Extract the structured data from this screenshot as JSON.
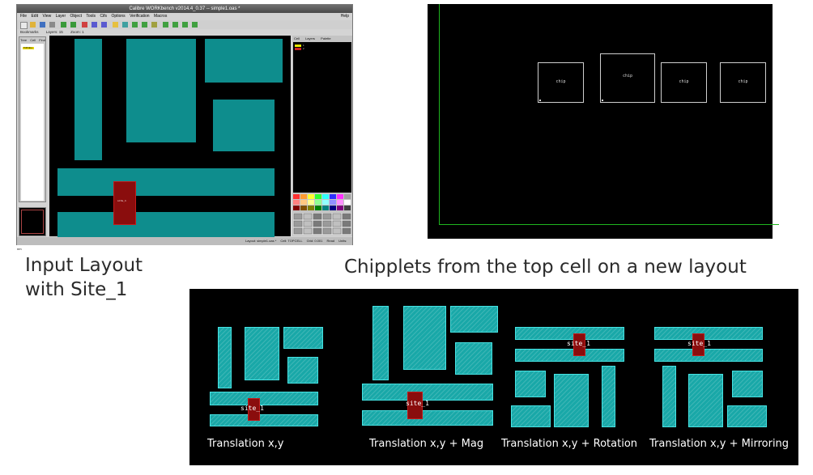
{
  "editor": {
    "window_title": "Calibre WORKbench v2014.4_0.37  --  simple1.oas *",
    "menu": [
      "File",
      "Edit",
      "View",
      "Layer",
      "Object",
      "Tools",
      "Cifs",
      "Options",
      "Verification",
      "Macros"
    ],
    "menu_help": "Help",
    "toolbar2": [
      "Bookmarks",
      "Layers: 15",
      "Zoom: 1"
    ],
    "panel_tabs": [
      "Tree",
      "Cell",
      "Find"
    ],
    "tree_root": "TOPCELL",
    "right_panel_tabs": [
      "Cell",
      "Layers",
      "Palette"
    ],
    "layer_names": [
      "1",
      "2"
    ],
    "site_label": "site_1",
    "status": [
      "Layout: simple1.oas *",
      "Cell: TOPCELL",
      "Grid: 0.001",
      "Read",
      "Units: nm"
    ]
  },
  "chiplets_view": {
    "chip_labels": [
      "chip",
      "chip",
      "chip",
      "chip"
    ]
  },
  "captions": {
    "input_line1": "Input Layout",
    "input_line2": "with Site_1",
    "chiplets": "Chipplets from the top cell on a new layout"
  },
  "transforms": {
    "site_label": "site_1",
    "labels": [
      "Translation x,y",
      "Translation x,y + Mag",
      "Translation x,y + Rotation",
      "Translation x,y + Mirroring"
    ]
  },
  "colors": {
    "shape_fill": "#0e8d8d",
    "shape_hatch": "#19a8a8",
    "site_fill": "#8a0d0d",
    "border_green": "#1fb51f"
  }
}
